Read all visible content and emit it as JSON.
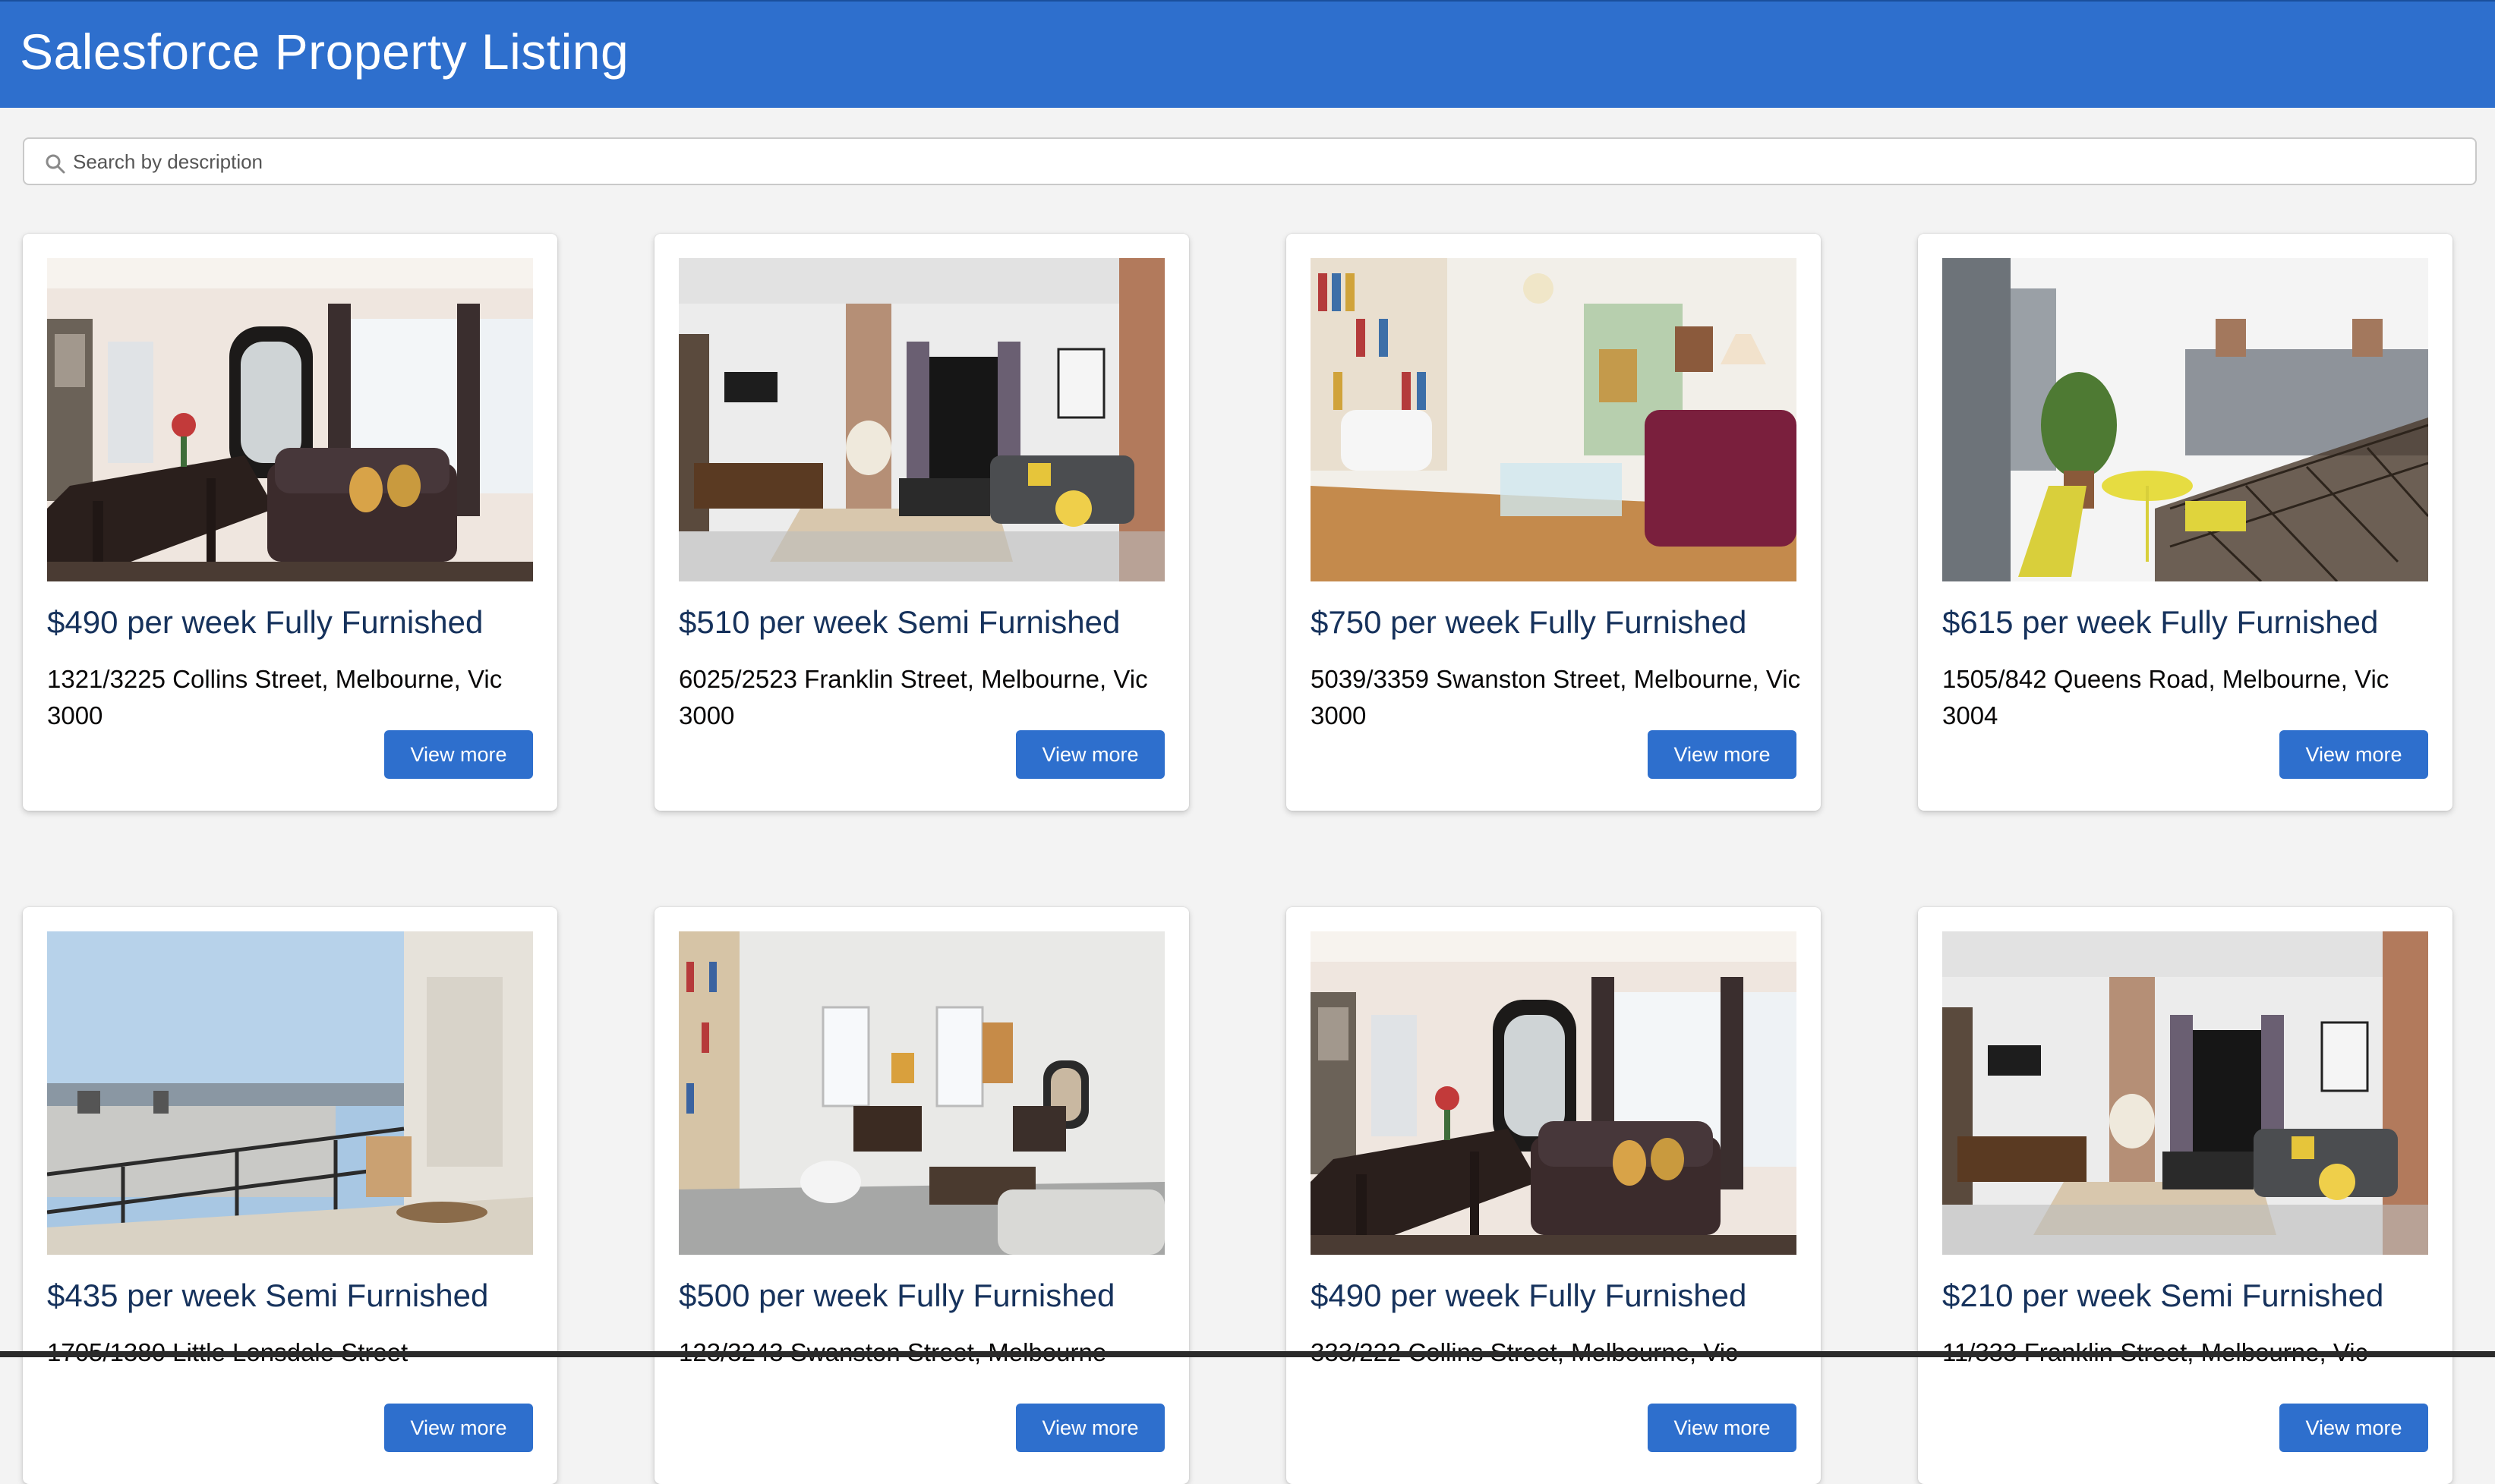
{
  "app": {
    "title": "Salesforce Property Listing",
    "brand_color": "#2e6fcd"
  },
  "search": {
    "placeholder": "Search by description",
    "value": ""
  },
  "listings": [
    {
      "price": "$490 per week Fully Furnished",
      "address": "1321/3225 Collins Street, Melbourne, Vic 3000",
      "button": "View more",
      "photo": "dining-living-room"
    },
    {
      "price": "$510 per week Semi Furnished",
      "address": "6025/2523 Franklin Street, Melbourne, Vic 3000",
      "button": "View more",
      "photo": "living-room-brick-wall"
    },
    {
      "price": "$750 per week Fully Furnished",
      "address": "5039/3359 Swanston Street, Melbourne, Vic 3000",
      "button": "View more",
      "photo": "living-room-bookshelf"
    },
    {
      "price": "$615 per week Fully Furnished",
      "address": "1505/842 Queens Road, Melbourne, Vic 3004",
      "button": "View more",
      "photo": "balcony-terrace"
    },
    {
      "price": "$435 per week Semi Furnished",
      "address": "1705/1380 Little Lonsdale Street",
      "button": "View more",
      "photo": "balcony-city-view"
    },
    {
      "price": "$500 per week Fully Furnished",
      "address": "123/3243 Swanston Street, Melbourne",
      "button": "View more",
      "photo": "bright-living-room"
    },
    {
      "price": "$490 per week Fully Furnished",
      "address": "333/222 Collins Street, Melbourne, Vic",
      "button": "View more",
      "photo": "dining-living-room"
    },
    {
      "price": "$210 per week Semi Furnished",
      "address": "11/333 Franklin Street, Melbourne, Vic",
      "button": "View more",
      "photo": "living-room-brick-wall"
    }
  ]
}
